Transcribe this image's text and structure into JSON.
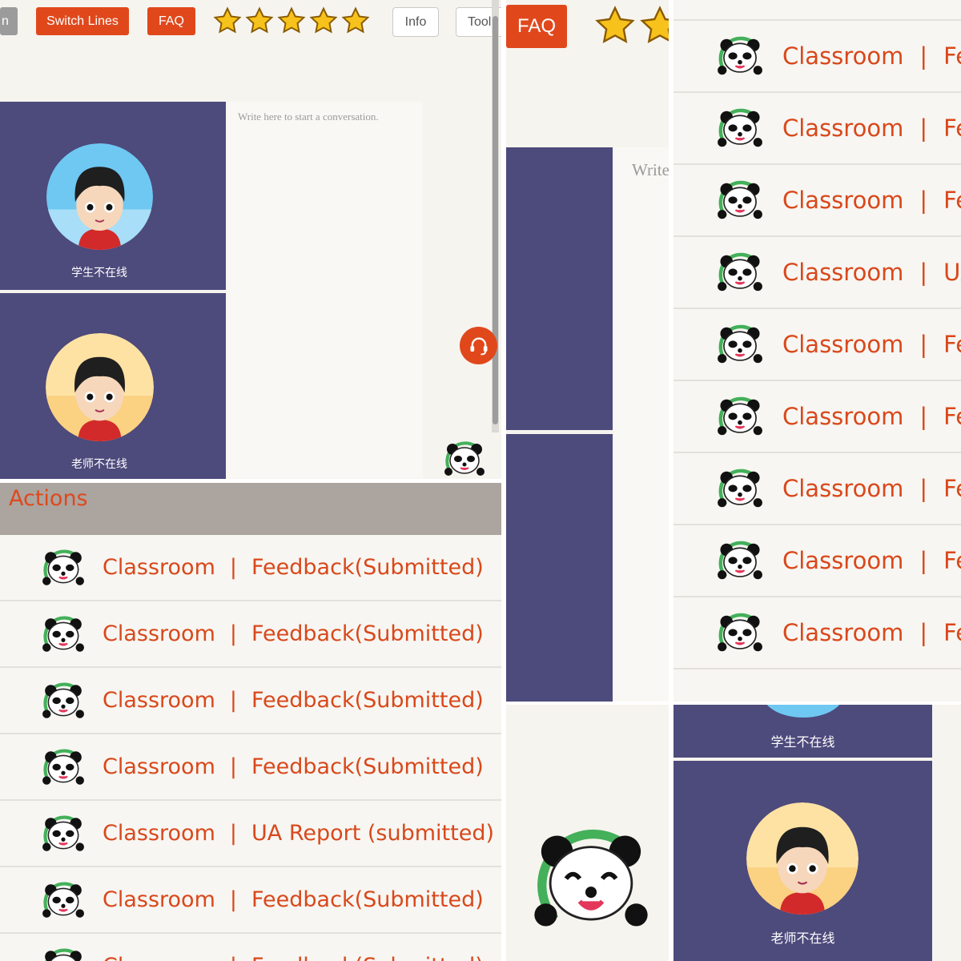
{
  "toolbar": {
    "partial_button_label": "n",
    "switch_lines_label": "Switch Lines",
    "faq_label": "FAQ",
    "info_label": "Info",
    "tools_label": "Tools",
    "rating_stars": 5
  },
  "chat": {
    "placeholder": "Write here to start a conversation.",
    "placeholder_partial": "Write"
  },
  "videos": {
    "student_status": "学生不在线",
    "teacher_status": "老师不在线"
  },
  "actions": {
    "title": "Actions",
    "rows": [
      {
        "left": "Classroom",
        "sep": "|",
        "right": "Feedback(Submitted)"
      },
      {
        "left": "Classroom",
        "sep": "|",
        "right": "Feedback(Submitted)"
      },
      {
        "left": "Classroom",
        "sep": "|",
        "right": "Feedback(Submitted)"
      },
      {
        "left": "Classroom",
        "sep": "|",
        "right": "Feedback(Submitted)"
      },
      {
        "left": "Classroom",
        "sep": "|",
        "right": "UA Report (submitted)"
      },
      {
        "left": "Classroom",
        "sep": "|",
        "right": "Feedback(Submitted)"
      },
      {
        "left": "Classroom",
        "sep": "|",
        "right": "Feedback(Submitted)"
      }
    ]
  },
  "right_list": {
    "rows": [
      {
        "left": "Classroom",
        "sep": "|",
        "right": "Fe"
      },
      {
        "left": "Classroom",
        "sep": "|",
        "right": "Fe"
      },
      {
        "left": "Classroom",
        "sep": "|",
        "right": "Fe"
      },
      {
        "left": "Classroom",
        "sep": "|",
        "right": "UA"
      },
      {
        "left": "Classroom",
        "sep": "|",
        "right": "Fe"
      },
      {
        "left": "Classroom",
        "sep": "|",
        "right": "Fe"
      },
      {
        "left": "Classroom",
        "sep": "|",
        "right": "Fe"
      },
      {
        "left": "Classroom",
        "sep": "|",
        "right": "Fe"
      },
      {
        "left": "Classroom",
        "sep": "|",
        "right": "Fe"
      }
    ]
  },
  "colors": {
    "accent": "#e0481c",
    "video_bg": "#4d4a7c",
    "page_bg": "#f6f4ef",
    "actions_bar": "#aba49f"
  }
}
